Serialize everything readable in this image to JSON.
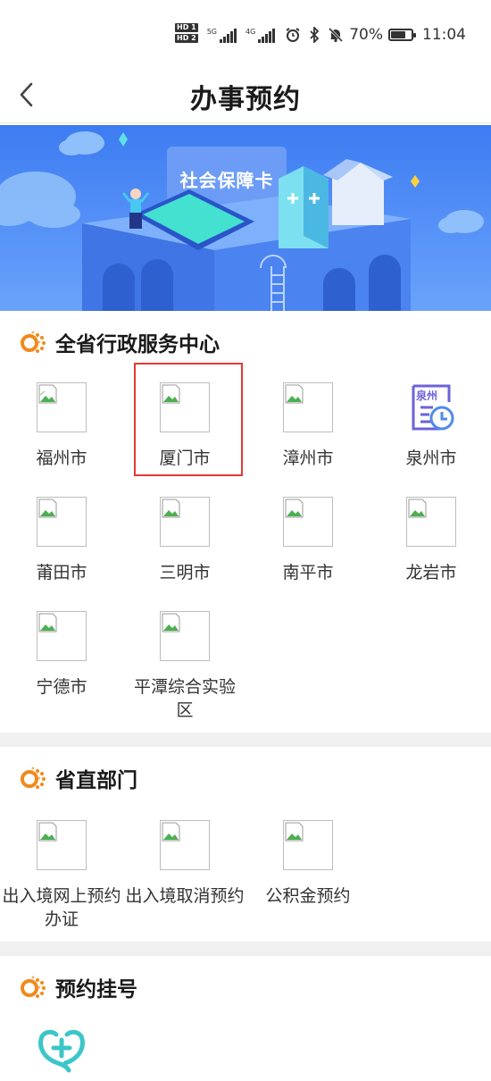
{
  "status_bar": {
    "hd1": "HD 1",
    "hd2": "HD 2",
    "net1": "5G",
    "net2": "4G",
    "battery": "70%",
    "time": "11:04"
  },
  "header": {
    "title": "办事预约"
  },
  "banner": {
    "text": "社会保障卡"
  },
  "sections": {
    "provincial_centers": {
      "title": "全省行政服务中心",
      "items": [
        {
          "label": "福州市"
        },
        {
          "label": "厦门市",
          "selected": true
        },
        {
          "label": "漳州市"
        },
        {
          "label": "泉州市",
          "badge": "泉州"
        },
        {
          "label": "莆田市"
        },
        {
          "label": "三明市"
        },
        {
          "label": "南平市"
        },
        {
          "label": "龙岩市"
        },
        {
          "label": "宁德市"
        },
        {
          "label": "平潭综合实验区"
        }
      ]
    },
    "provincial_departments": {
      "title": "省直部门",
      "items": [
        {
          "label": "出入境网上预约办证"
        },
        {
          "label": "出入境取消预约"
        },
        {
          "label": "公积金预约"
        }
      ]
    },
    "registration": {
      "title": "预约挂号"
    }
  },
  "colors": {
    "accent_orange": "#f08a1c",
    "banner_blue": "#4a86f5",
    "selection_red": "#e53935"
  }
}
